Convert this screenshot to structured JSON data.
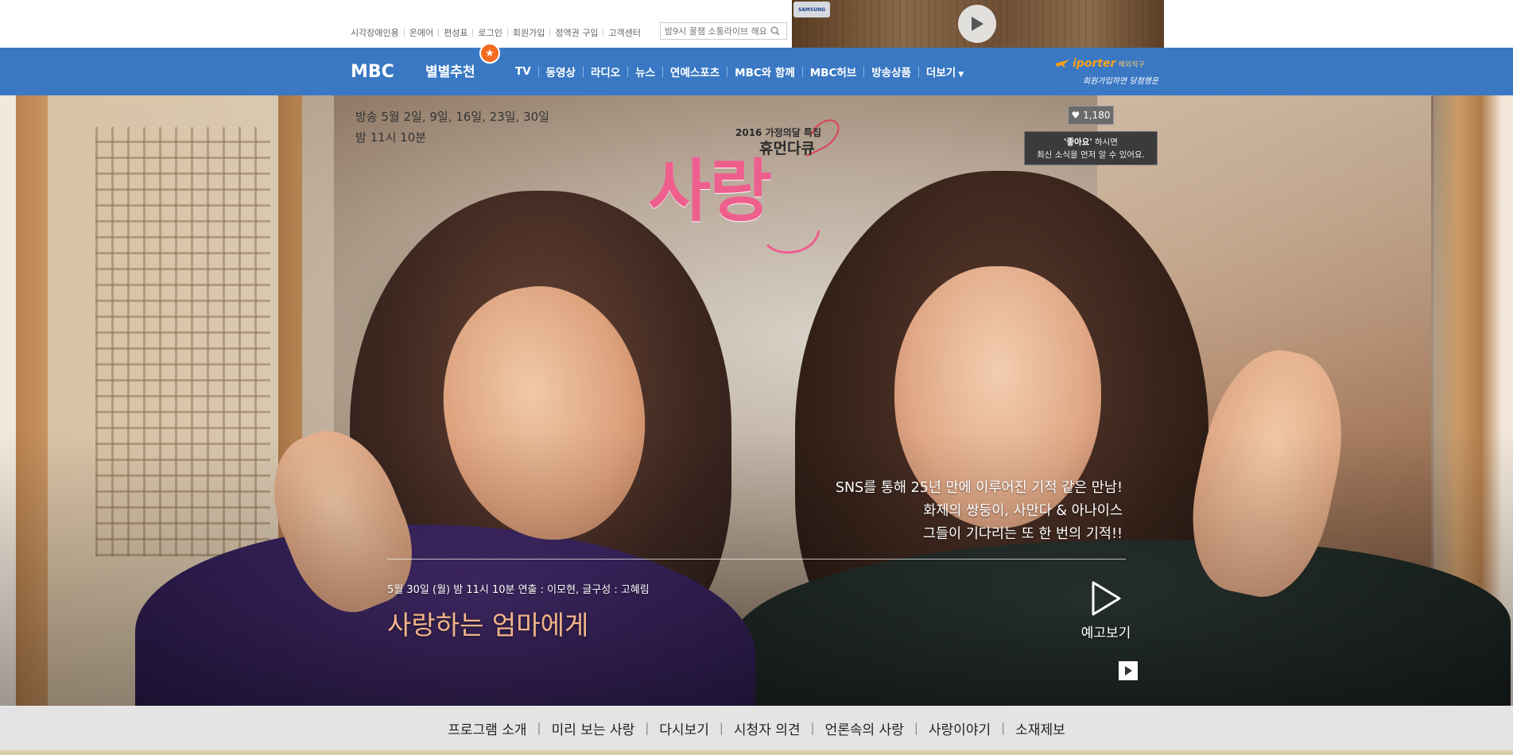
{
  "util": {
    "links": [
      "시각장애인용",
      "온에어",
      "편성표",
      "로그인",
      "회원가입",
      "정액권 구입",
      "고객센터"
    ],
    "search_placeholder": "밤9시 꿀잼 소통라이브 해요"
  },
  "ad": {
    "brand": "SAMSUNG"
  },
  "gnb": {
    "logo": "MBC",
    "reco": "별별추천",
    "menu": [
      "TV",
      "동영상",
      "라디오",
      "뉴스",
      "연예스포츠",
      "MBC와 함께",
      "MBC허브",
      "방송상품",
      "더보기"
    ],
    "iporter_brand": "iporter",
    "iporter_tag": "해외직구",
    "iporter_sub": "회원가입하면 당첨행운"
  },
  "hero": {
    "broadcast_dates": "방송 5월 2일, 9일, 16일, 23일, 30일",
    "broadcast_time": "밤 11시 10분",
    "special": "2016 가정의달 특집",
    "docu": "휴먼다큐",
    "program_title": "사랑",
    "like_count": "1,180",
    "like_tip_strong": "'좋아요'",
    "like_tip_rest": " 하시면",
    "like_tip_line2": "최신 소식을 먼저 알 수 있어요.",
    "tagline": [
      "SNS를 통해 25년 만에 이루어진 기적 같은 만남!",
      "화제의 쌍둥이, 사만다 & 아나이스",
      "그들이 기다리는 또 한 번의 기적!!"
    ],
    "episode_meta": "5월 30일 (월) 밤 11시 10분  연출 : 이모현, 글구성 : 고혜림",
    "episode_title": "사랑하는 엄마에게",
    "preview_label": "예고보기"
  },
  "program_nav": [
    "프로그램 소개",
    "미리 보는 사랑",
    "다시보기",
    "시청자 의견",
    "언론속의 사랑",
    "사랑이야기",
    "소재제보"
  ],
  "colors": {
    "gnb": "#3a78c3",
    "accent_pink": "#ee5f8e",
    "episode_title": "#f2b58a",
    "reco_badge": "#f26b21"
  }
}
